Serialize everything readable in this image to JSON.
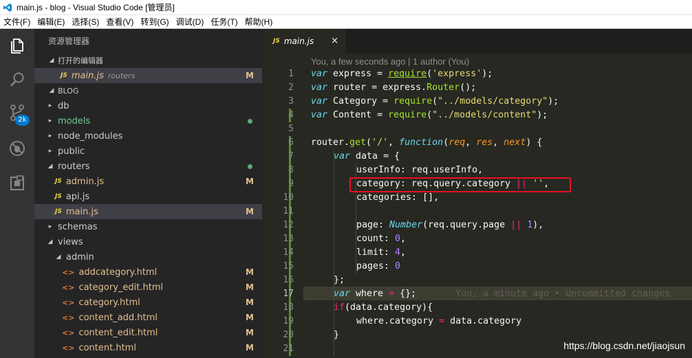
{
  "window": {
    "title": "main.js - blog - Visual Studio Code [管理员]"
  },
  "menu": [
    "文件(F)",
    "编辑(E)",
    "选择(S)",
    "查看(V)",
    "转到(G)",
    "调试(D)",
    "任务(T)",
    "帮助(H)"
  ],
  "activity": {
    "badge": "2k"
  },
  "sidebar": {
    "header": "资源管理器",
    "open_editors_label": "打开的编辑器",
    "open_editor": {
      "name": "main.js",
      "dir": "routers",
      "status": "M"
    },
    "project_label": "BLOG",
    "items": [
      {
        "name": "db",
        "status": ""
      },
      {
        "name": "models",
        "status": ""
      },
      {
        "name": "node_modules",
        "status": ""
      },
      {
        "name": "public",
        "status": ""
      },
      {
        "name": "routers",
        "status": ""
      },
      {
        "name": "admin.js",
        "status": "M"
      },
      {
        "name": "api.js",
        "status": ""
      },
      {
        "name": "main.js",
        "status": "M"
      },
      {
        "name": "schemas",
        "status": ""
      },
      {
        "name": "views",
        "status": ""
      },
      {
        "name": "admin",
        "status": ""
      },
      {
        "name": "addcategory.html",
        "status": "M"
      },
      {
        "name": "category_edit.html",
        "status": "M"
      },
      {
        "name": "category.html",
        "status": "M"
      },
      {
        "name": "content_add.html",
        "status": "M"
      },
      {
        "name": "content_edit.html",
        "status": "M"
      },
      {
        "name": "content.html",
        "status": "M"
      }
    ]
  },
  "editor": {
    "tab": {
      "name": "main.js",
      "close": "×"
    },
    "blame_top": "You, a few seconds ago | 1 author (You)",
    "inline_blame": "You, a minute ago • Uncommitted changes",
    "line_numbers": [
      "1",
      "2",
      "3",
      "4",
      "5",
      "6",
      "7",
      "8",
      "9",
      "10",
      "11",
      "12",
      "13",
      "14",
      "15",
      "16",
      "17",
      "18",
      "19",
      "20",
      "21"
    ],
    "lines": {
      "l1": {
        "a": "var",
        "b": " express = ",
        "c": "require",
        "d": "(",
        "e": "'express'",
        "f": ");"
      },
      "l2": {
        "a": "var",
        "b": " router = express.",
        "c": "Router",
        "d": "();"
      },
      "l3": {
        "a": "var",
        "b": " Category = ",
        "c": "require",
        "d": "(",
        "e": "\"../models/category\"",
        "f": ");"
      },
      "l4": {
        "a": "var",
        "b": " Content = ",
        "c": "require",
        "d": "(",
        "e": "\"../models/content\"",
        "f": ");"
      },
      "l6": {
        "a": "router.",
        "b": "get",
        "c": "(",
        "d": "'/'",
        "e": ", ",
        "f": "function",
        "g": "(",
        "h": "req",
        "i": ", ",
        "j": "res",
        "k": ", ",
        "l": "next",
        "m": ") {"
      },
      "l7": {
        "a": "var",
        "b": " data = {"
      },
      "l8": {
        "a": "userInfo: req.userInfo,"
      },
      "l9": {
        "a": "category: req.query.category ",
        "b": "||",
        "c": " ",
        "d": "''",
        "e": ","
      },
      "l10": {
        "a": "categories: [],"
      },
      "l12": {
        "a": "page: ",
        "b": "Number",
        "c": "(req.query.page ",
        "d": "||",
        "e": " ",
        "f": "1",
        "g": "),"
      },
      "l13": {
        "a": "count: ",
        "b": "0",
        "c": ","
      },
      "l14": {
        "a": "limit: ",
        "b": "4",
        "c": ","
      },
      "l15": {
        "a": "pages: ",
        "b": "0"
      },
      "l16": {
        "a": "};"
      },
      "l17": {
        "a": "var",
        "b": " where ",
        "c": "=",
        "d": " {};"
      },
      "l18": {
        "a": "if",
        "b": "(data.category){"
      },
      "l19": {
        "a": "where.category ",
        "b": "=",
        "c": " data.category"
      },
      "l20": {
        "a": "}"
      }
    }
  },
  "watermark": "https://blog.csdn.net/jiaojsun",
  "colors": {
    "activity_bar": "#333333",
    "sidebar": "#252526",
    "editor": "#272822",
    "badge": "#007acc",
    "highlight_box": "#e81123"
  }
}
